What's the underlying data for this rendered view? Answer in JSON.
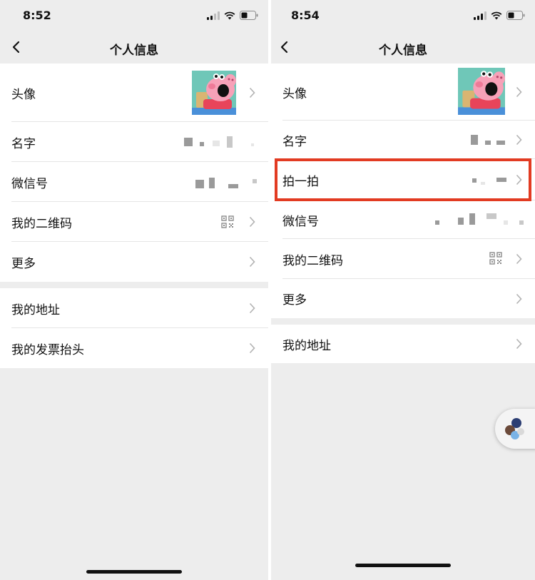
{
  "left_screen": {
    "status_bar": {
      "time": "8:52"
    },
    "nav": {
      "title": "个人信息"
    },
    "group1": [
      {
        "label": "头像"
      },
      {
        "label": "名字"
      },
      {
        "label": "微信号"
      },
      {
        "label": "我的二维码"
      },
      {
        "label": "更多"
      }
    ],
    "group2": [
      {
        "label": "我的地址"
      },
      {
        "label": "我的发票抬头"
      }
    ]
  },
  "right_screen": {
    "status_bar": {
      "time": "8:54"
    },
    "nav": {
      "title": "个人信息"
    },
    "group1": [
      {
        "label": "头像"
      },
      {
        "label": "名字"
      },
      {
        "label": "拍一拍"
      },
      {
        "label": "微信号"
      },
      {
        "label": "我的二维码"
      },
      {
        "label": "更多"
      }
    ],
    "group2": [
      {
        "label": "我的地址"
      }
    ]
  },
  "annotation": {
    "highlight_color": "#e23b22",
    "highlighted_item": "拍一拍"
  },
  "icons": {
    "back": "chevron-left-icon",
    "disclosure": "chevron-right-icon",
    "qr": "qr-code-icon",
    "signal": "signal-icon",
    "wifi": "wifi-icon",
    "battery": "battery-icon"
  },
  "colors": {
    "background": "#ededed",
    "cell": "#ffffff",
    "divider": "#e5e5e5",
    "chevron": "#b2b2b2"
  }
}
